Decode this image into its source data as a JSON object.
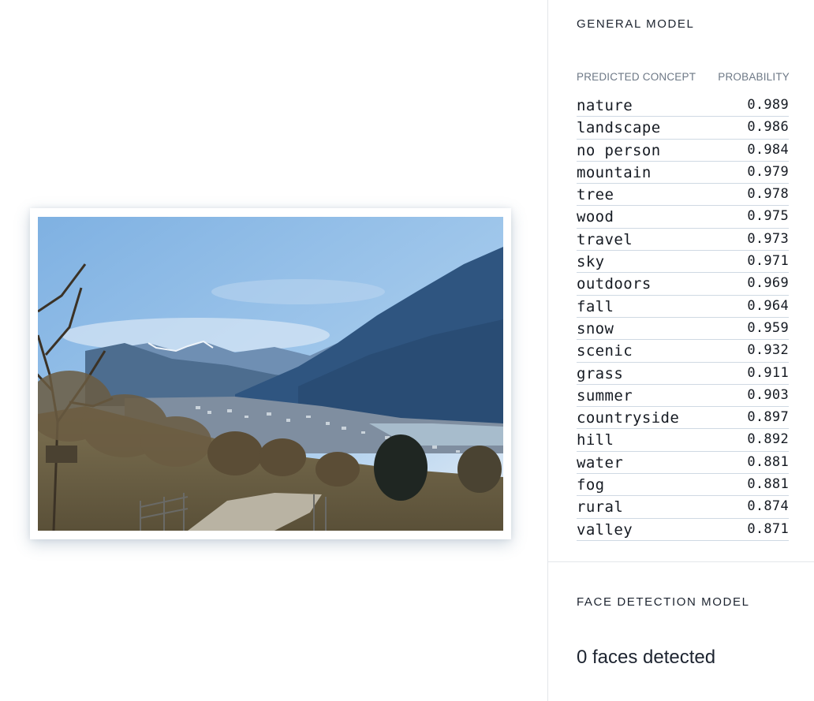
{
  "image": {
    "subject": "mountain valley landscape photo",
    "colors": {
      "sky": "#8dbbe6",
      "mountain": "#2f5580",
      "foreground": "#6a5e47"
    }
  },
  "general_model": {
    "title": "GENERAL MODEL",
    "columns": {
      "concept": "PREDICTED CONCEPT",
      "probability": "PROBABILITY"
    },
    "concepts": [
      {
        "name": "nature",
        "probability": "0.989"
      },
      {
        "name": "landscape",
        "probability": "0.986"
      },
      {
        "name": "no person",
        "probability": "0.984"
      },
      {
        "name": "mountain",
        "probability": "0.979"
      },
      {
        "name": "tree",
        "probability": "0.978"
      },
      {
        "name": "wood",
        "probability": "0.975"
      },
      {
        "name": "travel",
        "probability": "0.973"
      },
      {
        "name": "sky",
        "probability": "0.971"
      },
      {
        "name": "outdoors",
        "probability": "0.969"
      },
      {
        "name": "fall",
        "probability": "0.964"
      },
      {
        "name": "snow",
        "probability": "0.959"
      },
      {
        "name": "scenic",
        "probability": "0.932"
      },
      {
        "name": "grass",
        "probability": "0.911"
      },
      {
        "name": "summer",
        "probability": "0.903"
      },
      {
        "name": "countryside",
        "probability": "0.897"
      },
      {
        "name": "hill",
        "probability": "0.892"
      },
      {
        "name": "water",
        "probability": "0.881"
      },
      {
        "name": "fog",
        "probability": "0.881"
      },
      {
        "name": "rural",
        "probability": "0.874"
      },
      {
        "name": "valley",
        "probability": "0.871"
      }
    ]
  },
  "face_detection_model": {
    "title": "FACE DETECTION MODEL",
    "result": "0 faces detected"
  }
}
